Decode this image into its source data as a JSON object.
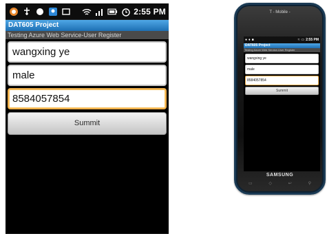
{
  "status_bar": {
    "time": "2:55 PM",
    "icons": [
      "app-icon",
      "usb-icon",
      "notification-icon",
      "map-icon",
      "image-icon",
      "wifi-icon",
      "signal-icon",
      "battery-icon",
      "alarm-icon"
    ]
  },
  "app": {
    "title": "DAT605 Project",
    "subtitle": "Testing Azure Web Service-User Register"
  },
  "form": {
    "name_value": "wangxing ye",
    "gender_value": "male",
    "phone_value": "8584057854",
    "submit_label": "Summit"
  },
  "phone": {
    "carrier": "T - Mobile -",
    "brand": "SAMSUNG"
  },
  "colors": {
    "title_bar": "#1d6fb3",
    "focus_border": "#f1b04b"
  }
}
